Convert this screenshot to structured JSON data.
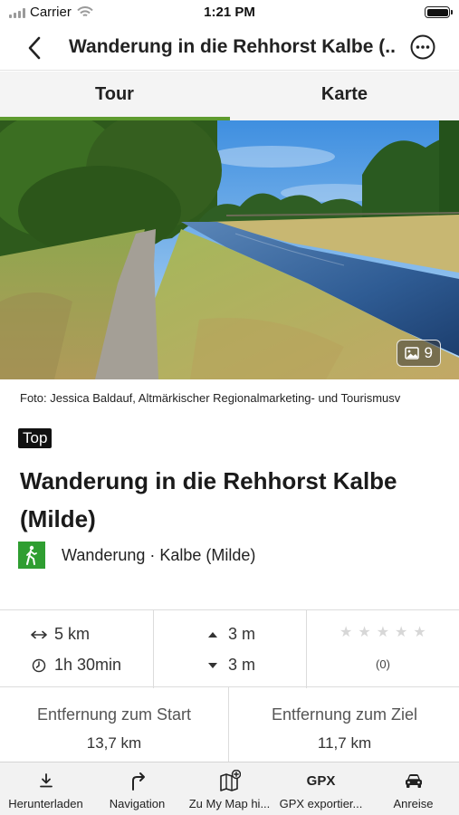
{
  "status_bar": {
    "carrier": "Carrier",
    "time": "1:21 PM",
    "battery_level": 1.0
  },
  "nav": {
    "title": "Wanderung in die Rehhorst Kalbe (...",
    "back_icon": "chevron-left-icon",
    "more_icon": "more-circle-icon"
  },
  "tabs": [
    {
      "label": "Tour",
      "active": true
    },
    {
      "label": "Karte",
      "active": false
    }
  ],
  "colors": {
    "accent": "#5e9b2f",
    "category_green": "#2f9e31",
    "top_badge": "#111111"
  },
  "hero": {
    "image_count": "9",
    "gallery_icon": "image-icon"
  },
  "photo_credit": "Foto: Jessica Baldauf, Altmärkischer Regionalmarketing- und Tourismusv",
  "badge": "Top",
  "tour": {
    "title": "Wanderung in die Rehhorst Kalbe (Milde)",
    "category": "Wanderung · Kalbe (Milde)",
    "category_icon": "hiker-icon"
  },
  "stats": {
    "distance": "5 km",
    "duration": "1h 30min",
    "ascent": "3 m",
    "descent": "3 m",
    "rating_stars": 0,
    "rating_max": 5,
    "rating_count": "(0)"
  },
  "distances": {
    "start_label": "Entfernung zum Start",
    "start_value": "13,7 km",
    "end_label": "Entfernung zum Ziel",
    "end_value": "11,7 km"
  },
  "bottom_bar": [
    {
      "label": "Herunterladen",
      "icon": "download-icon"
    },
    {
      "label": "Navigation",
      "icon": "turn-right-arrow-icon"
    },
    {
      "label": "Zu My Map hi...",
      "icon": "add-to-map-icon"
    },
    {
      "label": "GPX exportier...",
      "icon": "gpx-icon",
      "icon_text": "GPX"
    },
    {
      "label": "Anreise",
      "icon": "car-icon"
    }
  ]
}
